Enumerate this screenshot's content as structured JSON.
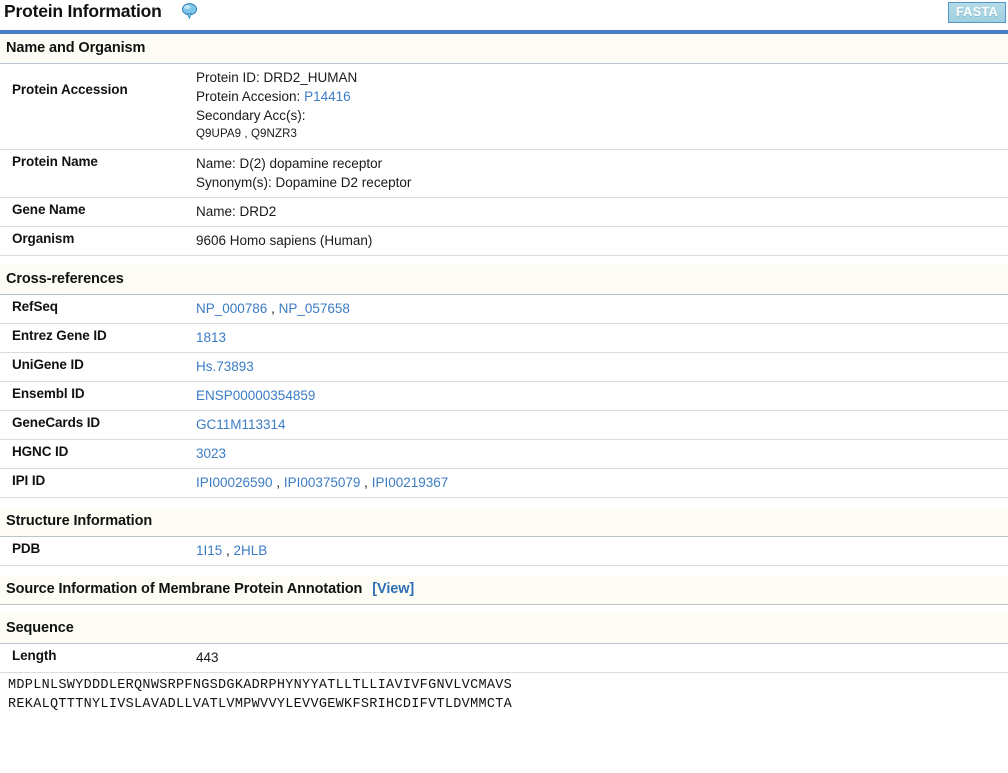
{
  "header": {
    "title": "Protein Information",
    "help_icon": "speech-balloon-icon",
    "fasta_label": "FASTA",
    "accent_color": "#4a7dc4",
    "fasta_bg": "#a8d6e4",
    "link_color": "#3b7cc4"
  },
  "sections": {
    "name_and_organism": {
      "heading": "Name and Organism",
      "rows": [
        {
          "label": "Protein Accession",
          "protein_id_label": "Protein ID:",
          "protein_id_value": "DRD2_HUMAN",
          "accession_label": "Protein Accesion:",
          "accession_value": "P14416",
          "secondary_label": "Secondary Acc(s):",
          "secondary_values": "Q9UPA9 , Q9NZR3"
        },
        {
          "label": "Protein Name",
          "name_line": "Name: D(2) dopamine receptor",
          "synonym_line": "Synonym(s): Dopamine D2 receptor"
        },
        {
          "label": "Gene Name",
          "value": "Name: DRD2"
        },
        {
          "label": "Organism",
          "value": "9606 Homo sapiens (Human)"
        }
      ]
    },
    "cross_references": {
      "heading": "Cross-references",
      "rows": [
        {
          "label": "RefSeq",
          "links": [
            "NP_000786",
            "NP_057658"
          ]
        },
        {
          "label": "Entrez Gene ID",
          "links": [
            "1813"
          ]
        },
        {
          "label": "UniGene ID",
          "links": [
            "Hs.73893"
          ]
        },
        {
          "label": "Ensembl ID",
          "links": [
            "ENSP00000354859"
          ]
        },
        {
          "label": "GeneCards ID",
          "links": [
            "GC11M113314"
          ]
        },
        {
          "label": "HGNC ID",
          "links": [
            "3023"
          ]
        },
        {
          "label": "IPI ID",
          "links": [
            "IPI00026590",
            "IPI00375079",
            "IPI00219367"
          ]
        }
      ]
    },
    "structure_information": {
      "heading": "Structure Information",
      "rows": [
        {
          "label": "PDB",
          "links": [
            "1I15",
            "2HLB"
          ]
        }
      ]
    },
    "source_information": {
      "heading": "Source Information of Membrane Protein Annotation",
      "view_link": "[View]"
    },
    "sequence": {
      "heading": "Sequence",
      "length_label": "Length",
      "length_value": "443",
      "lines": [
        "MDPLNLSWYDDDLERQNWSRPFNGSDGKADRPHYNYYATLLTLLIAVIVFGNVLVCMAVS",
        "REKALQTTTNYLIVSLAVADLLVATLVMPWVVYLEVVGEWKFSRIHCDIFVTLDVMMCTA"
      ]
    }
  }
}
